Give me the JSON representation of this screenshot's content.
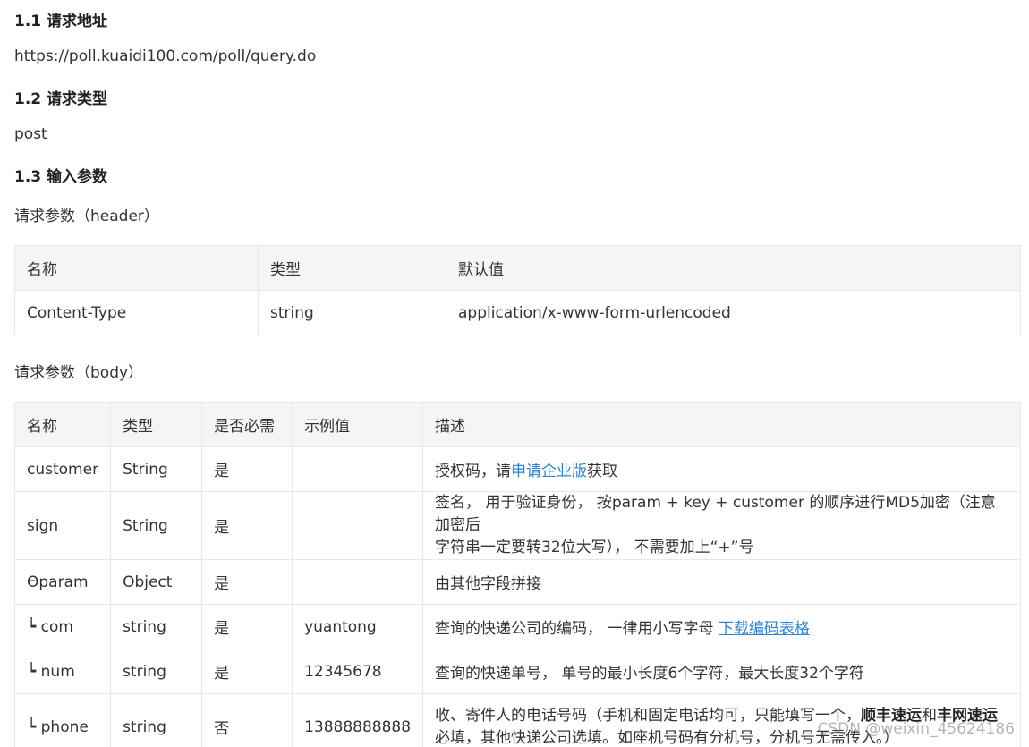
{
  "sections": {
    "s1": {
      "title": "1.1 请求地址",
      "url": "https://poll.kuaidi100.com/poll/query.do"
    },
    "s2": {
      "title": "1.2 请求类型",
      "method": "post"
    },
    "s3": {
      "title": "1.3 输入参数"
    }
  },
  "header_table": {
    "caption": "请求参数（header）",
    "columns": [
      "名称",
      "类型",
      "默认值"
    ],
    "rows": [
      [
        "Content-Type",
        "string",
        "application/x-www-form-urlencoded"
      ]
    ]
  },
  "body_table": {
    "caption": "请求参数（body）",
    "columns": [
      "名称",
      "类型",
      "是否必需",
      "示例值",
      "描述"
    ],
    "rows": [
      {
        "name": "customer",
        "type": "String",
        "required": "是",
        "example": "",
        "desc_pre": "授权码，请",
        "desc_link": "申请企业版",
        "desc_post": "获取"
      },
      {
        "name": "sign",
        "type": "String",
        "required": "是",
        "example": "",
        "desc_line1": "签名， 用于验证身份， 按param + key + customer 的顺序进行MD5加密（注意加密后",
        "desc_line2": "字符串一定要转32位大写）， 不需要加上“+”号"
      },
      {
        "name": "Θparam",
        "type": "Object",
        "required": "是",
        "example": "",
        "desc": "由其他字段拼接"
      },
      {
        "name": "┕ com",
        "type": "string",
        "required": "是",
        "example": "yuantong",
        "desc_pre": "查询的快递公司的编码， 一律用小写字母 ",
        "desc_link": "下载编码表格"
      },
      {
        "name": "┕ num",
        "type": "string",
        "required": "是",
        "example": "12345678",
        "desc": "查询的快递单号， 单号的最小长度6个字符，最大长度32个字符"
      },
      {
        "name": "┕ phone",
        "type": "string",
        "required": "否",
        "example": "13888888888",
        "desc_pre": "收、寄件人的电话号码（手机和固定电话均可，只能填写一个，",
        "desc_bold1": "顺丰速运",
        "desc_mid": "和",
        "desc_bold2": "丰网速运",
        "desc_line2": "必填，其他快递公司选填。如座机号码有分机号，分机号无需传入。）"
      }
    ]
  },
  "watermark": "CSDN @weixin_45624186"
}
